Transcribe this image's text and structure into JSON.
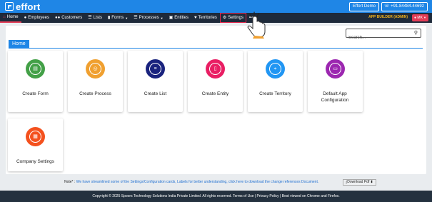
{
  "topbar": {
    "brand": "effort",
    "demo_label": "Effort Demo",
    "phone": "+91.84484.44692",
    "phone_icon": "headset-icon"
  },
  "navbar": {
    "items": [
      {
        "label": "Home",
        "icon": "home-icon"
      },
      {
        "label": "Employees",
        "icon": "user-icon"
      },
      {
        "label": "Customers",
        "icon": "users-icon"
      },
      {
        "label": "Lists",
        "icon": "list-icon"
      },
      {
        "label": "Forms",
        "icon": "file-icon"
      },
      {
        "label": "Processes",
        "icon": "menu-icon"
      },
      {
        "label": "Entities",
        "icon": "entity-icon"
      },
      {
        "label": "Territories",
        "icon": "map-pin-icon"
      },
      {
        "label": "Settings",
        "icon": "gears-icon"
      },
      {
        "label": "•••",
        "icon": "more-icon"
      }
    ],
    "app_builder": "APP BUILDER (ADMIN)",
    "user_badge": "MK"
  },
  "search": {
    "placeholder": "Search..."
  },
  "section_title": "Home",
  "cards": [
    {
      "label": "Create Form",
      "icon": "form-icon",
      "color": "#43a047"
    },
    {
      "label": "Create Process",
      "icon": "process-icon",
      "color": "#f0a030"
    },
    {
      "label": "Create List",
      "icon": "list-icon",
      "color": "#1a237e"
    },
    {
      "label": "Create Entity",
      "icon": "entity-icon",
      "color": "#e91e63"
    },
    {
      "label": "Create Territory",
      "icon": "territory-icon",
      "color": "#2196f3"
    },
    {
      "label": "Default App Configuration",
      "icon": "config-icon",
      "color": "#9c27b0"
    },
    {
      "label": "Company Settings",
      "icon": "settings-icon",
      "color": "#f4511e"
    }
  ],
  "note": {
    "prefix": "Note* :",
    "text": "We have streamlined some of the Settings/Configuration cards, Labels for better understanding, click here to download the change references Document.",
    "download_label": "Download Pdf"
  },
  "footer": "Copyright © 2025 Spoors Technology Solutions India Private Limited. All rights reserved. Terms of Use | Privacy Policy | Best viewed on Chrome and Firefox.",
  "colors": {
    "primary": "#1f86e6",
    "nav_bg": "#1e2a3a",
    "accent": "#e43d57",
    "builder": "#f2b21c"
  }
}
